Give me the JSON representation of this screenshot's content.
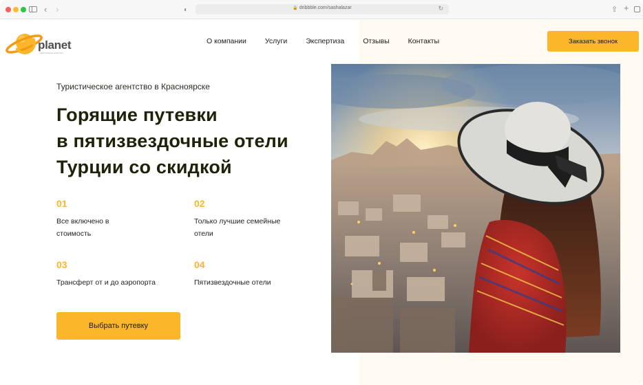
{
  "browser": {
    "url": "dribbble.com/sashalazar"
  },
  "header": {
    "logo_text": "planet",
    "logo_tagline": "туристическое агентство",
    "nav": [
      {
        "label": "О компании"
      },
      {
        "label": "Услуги"
      },
      {
        "label": "Экспертиза"
      },
      {
        "label": "Отзывы"
      },
      {
        "label": "Контакты"
      }
    ],
    "cta_label": "Заказать звонок"
  },
  "hero": {
    "subtitle": "Туристическое агентство в Красноярске",
    "headline": [
      "Горящие путевки",
      "в пятизвездочные отели",
      "Турции со скидкой"
    ],
    "features": [
      {
        "number": "01",
        "text": "Все включено в стоимость"
      },
      {
        "number": "02",
        "text": "Только лучшие семейные отели"
      },
      {
        "number": "03",
        "text": "Трансферт от и до аэропорта"
      },
      {
        "number": "04",
        "text": "Пятизвездочные отели"
      }
    ],
    "cta_label": "Выбрать путевку",
    "image_description": "woman-in-sunhat-overlooking-cappadocia"
  },
  "colors": {
    "accent": "#fbb729",
    "headline": "#1d2208",
    "accent_background": "#fef9f1"
  }
}
